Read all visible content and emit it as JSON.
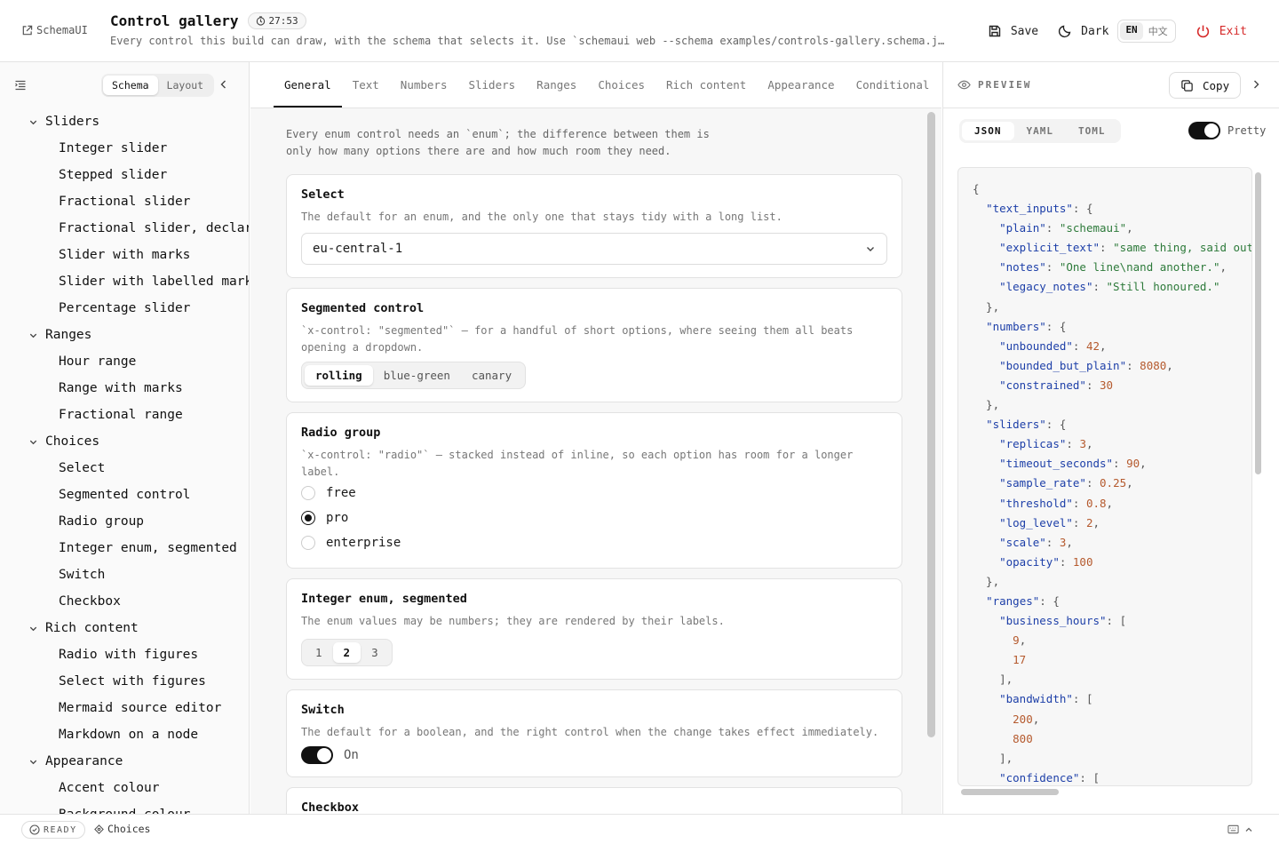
{
  "app": {
    "brand": "SchemaUI",
    "title": "Control gallery",
    "timer": "27:53",
    "subtitle": "Every control this build can draw, with the schema that selects it. Use `schemaui web --schema examples/controls-gallery.schema.json` to run it yourself."
  },
  "top_actions": {
    "save": "Save",
    "theme": "Dark",
    "lang": [
      "EN",
      "中文"
    ],
    "lang_selected": "EN",
    "exit": "Exit"
  },
  "sidebar": {
    "modes": [
      "Schema",
      "Layout"
    ],
    "mode_selected": "Schema",
    "tree": [
      {
        "label": "Sliders",
        "group": true
      },
      {
        "label": "Integer slider"
      },
      {
        "label": "Stepped slider"
      },
      {
        "label": "Fractional slider"
      },
      {
        "label": "Fractional slider, declared"
      },
      {
        "label": "Slider with marks"
      },
      {
        "label": "Slider with labelled marks"
      },
      {
        "label": "Percentage slider"
      },
      {
        "label": "Ranges",
        "group": true
      },
      {
        "label": "Hour range"
      },
      {
        "label": "Range with marks"
      },
      {
        "label": "Fractional range"
      },
      {
        "label": "Choices",
        "group": true
      },
      {
        "label": "Select"
      },
      {
        "label": "Segmented control"
      },
      {
        "label": "Radio group"
      },
      {
        "label": "Integer enum, segmented"
      },
      {
        "label": "Switch"
      },
      {
        "label": "Checkbox"
      },
      {
        "label": "Rich content",
        "group": true
      },
      {
        "label": "Radio with figures"
      },
      {
        "label": "Select with figures"
      },
      {
        "label": "Mermaid source editor"
      },
      {
        "label": "Markdown on a node"
      },
      {
        "label": "Appearance",
        "group": true
      },
      {
        "label": "Accent colour"
      },
      {
        "label": "Background colour"
      }
    ]
  },
  "tabs": [
    "General",
    "Text",
    "Numbers",
    "Sliders",
    "Ranges",
    "Choices",
    "Rich content",
    "Appearance",
    "Conditional"
  ],
  "tab_selected": "General",
  "main": {
    "intro": "Every enum control needs an `enum`; the difference between them is only how many options there are and how much room they need.",
    "select": {
      "title": "Select",
      "desc": "The default for an enum, and the only one that stays tidy with a long list.",
      "value": "eu-central-1"
    },
    "segmented": {
      "title": "Segmented control",
      "desc": "`x-control: \"segmented\"` — for a handful of short options, where seeing them all beats opening a dropdown.",
      "options": [
        "rolling",
        "blue-green",
        "canary"
      ],
      "selected": "rolling"
    },
    "radio": {
      "title": "Radio group",
      "desc": "`x-control: \"radio\"` — stacked instead of inline, so each option has room for a longer label.",
      "options": [
        "free",
        "pro",
        "enterprise"
      ],
      "selected": "pro"
    },
    "int_enum": {
      "title": "Integer enum, segmented",
      "desc": "The enum values may be numbers; they are rendered by their labels.",
      "options": [
        "1",
        "2",
        "3"
      ],
      "selected": "2"
    },
    "switch": {
      "title": "Switch",
      "desc": "The default for a boolean, and the right control when the change takes effect immediately.",
      "state": "On"
    },
    "checkbox": {
      "title": "Checkbox"
    }
  },
  "preview": {
    "label": "PREVIEW",
    "copy": "Copy",
    "formats": [
      "JSON",
      "YAML",
      "TOML"
    ],
    "format_selected": "JSON",
    "pretty_label": "Pretty",
    "pretty_on": true,
    "code": "{\n  \"text_inputs\": {\n    \"plain\": \"schemaui\",\n    \"explicit_text\": \"same thing, said out loud\",\n    \"notes\": \"One line\\nand another.\",\n    \"legacy_notes\": \"Still honoured.\"\n  },\n  \"numbers\": {\n    \"unbounded\": 42,\n    \"bounded_but_plain\": 8080,\n    \"constrained\": 30\n  },\n  \"sliders\": {\n    \"replicas\": 3,\n    \"timeout_seconds\": 90,\n    \"sample_rate\": 0.25,\n    \"threshold\": 0.8,\n    \"log_level\": 2,\n    \"scale\": 3,\n    \"opacity\": 100\n  },\n  \"ranges\": {\n    \"business_hours\": [\n      9,\n      17\n    ],\n    \"bandwidth\": [\n      200,\n      800\n    ],\n    \"confidence\": ["
  },
  "status": {
    "ready": "READY",
    "crumb": "Choices"
  }
}
